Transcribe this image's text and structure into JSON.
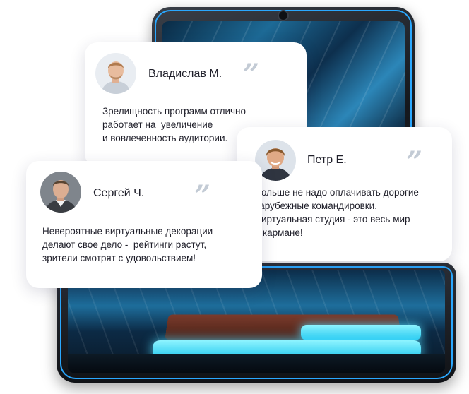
{
  "colors": {
    "accent_blue": "#2aa8ff",
    "glow_purple": "#be78ff",
    "quote_gray": "#c3cbd5",
    "text": "#1f1f2a"
  },
  "illustration": {
    "icon": "tablet-virtual-studio-illustration"
  },
  "reviews": [
    {
      "name": "Владислав М.",
      "quote": "”",
      "lines": [
        "Зрелищность программ отлично",
        "работает на  увеличение",
        "и вовлеченность аудитории."
      ]
    },
    {
      "name": "Петр Е.",
      "quote": "”",
      "lines": [
        "Больше не надо оплачивать дорогие",
        "зарубежные командировки.",
        "Виртуальная студия - это весь мир",
        "в кармане!"
      ]
    },
    {
      "name": "Сергей Ч.",
      "quote": "”",
      "lines": [
        "Невероятные виртуальные декорации",
        "делают свое дело -  рейтинги растут,",
        "зрители смотрят с удовольствием!"
      ]
    }
  ]
}
